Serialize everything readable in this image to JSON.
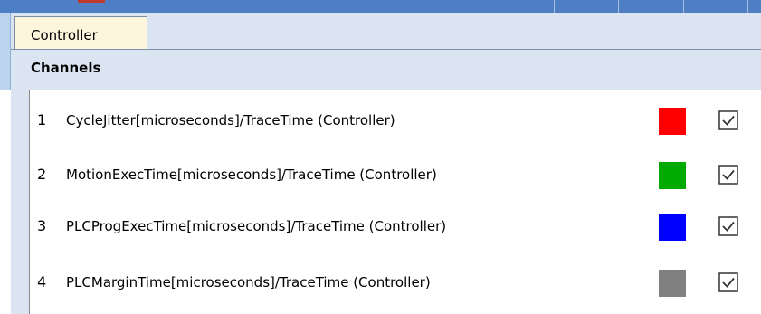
{
  "tabs": [
    {
      "label": "Controller",
      "active": true
    }
  ],
  "section": {
    "title": "Channels"
  },
  "channels": [
    {
      "index": "1",
      "name": "CycleJitter[microseconds]/TraceTime (Controller)",
      "color": "#ff0000",
      "checked": true
    },
    {
      "index": "2",
      "name": "MotionExecTime[microseconds]/TraceTime (Controller)",
      "color": "#00aa00",
      "checked": true
    },
    {
      "index": "3",
      "name": "PLCProgExecTime[microseconds]/TraceTime (Controller)",
      "color": "#0000ff",
      "checked": true
    },
    {
      "index": "4",
      "name": "PLCMarginTime[microseconds]/TraceTime (Controller)",
      "color": "#808080",
      "checked": true
    }
  ]
}
